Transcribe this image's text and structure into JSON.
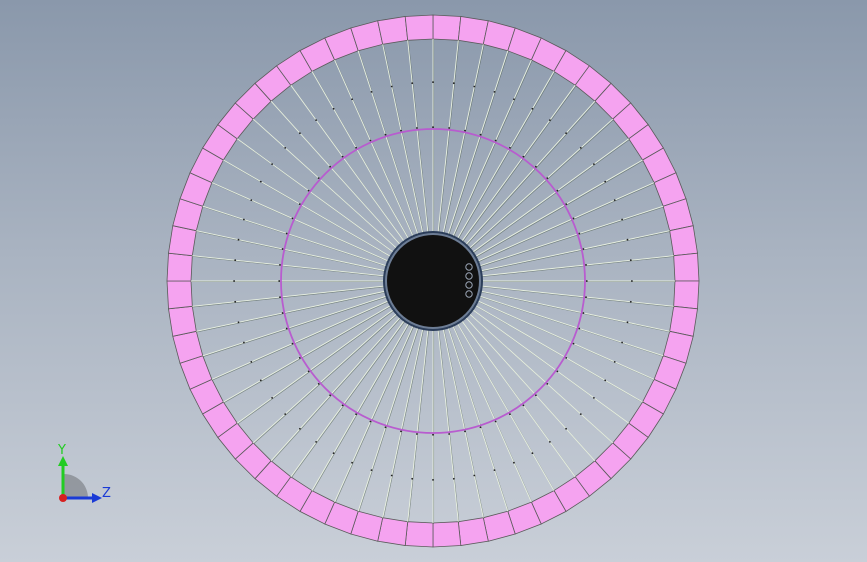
{
  "viewport": {
    "background_top": "#8a98ab",
    "background_bottom": "#c9cfd8"
  },
  "model": {
    "description_icon": "wheel-model",
    "rim_segment_color": "#f5a3f0",
    "rim_segment_stroke": "#5a5a5a",
    "rim_segment_count": 60,
    "spoke_color": "#e8f0e0",
    "spoke_shadow_color": "#4a5a4a",
    "inner_ring_color": "#b85ccf",
    "hub_color": "#111111",
    "hub_rim_color": "#2c3e5a"
  },
  "triad": {
    "y_label": "Y",
    "z_label": "Z",
    "y_color": "#22cc22",
    "z_color": "#1a3ad6",
    "x_color": "#d62020"
  }
}
